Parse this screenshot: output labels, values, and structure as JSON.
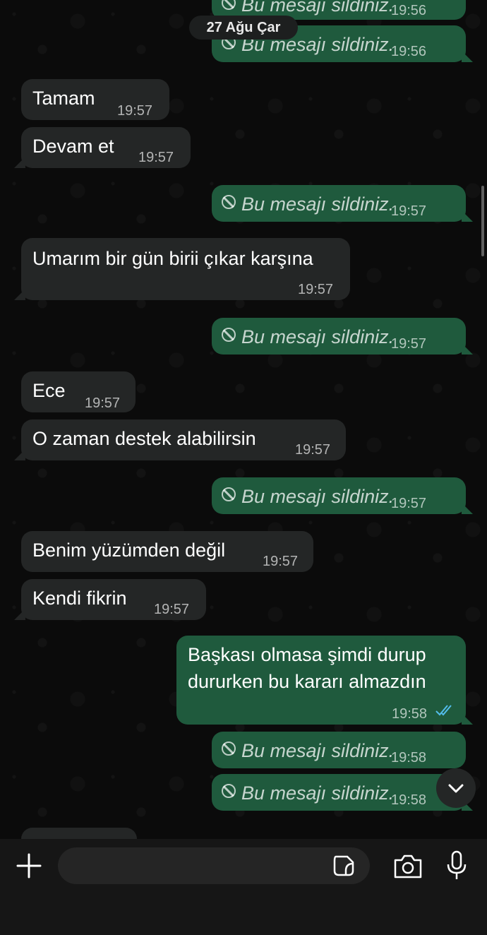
{
  "header": {
    "date": "27 Ağu Çar"
  },
  "messages": [
    {
      "dir": "out",
      "deleted": true,
      "text": "Bu mesajı sildiniz.",
      "time": "19:56"
    },
    {
      "dir": "out",
      "deleted": true,
      "text": "Bu mesajı sildiniz.",
      "time": "19:56"
    },
    {
      "dir": "in",
      "text": "Tamam",
      "time": "19:57"
    },
    {
      "dir": "in",
      "text": "Devam et",
      "time": "19:57"
    },
    {
      "dir": "out",
      "deleted": true,
      "text": "Bu mesajı sildiniz.",
      "time": "19:57"
    },
    {
      "dir": "in",
      "text": "Umarım bir gün birii çıkar karşına",
      "time": "19:57"
    },
    {
      "dir": "out",
      "deleted": true,
      "text": "Bu mesajı sildiniz.",
      "time": "19:57"
    },
    {
      "dir": "in",
      "text": "Ece",
      "time": "19:57"
    },
    {
      "dir": "in",
      "text": "O zaman destek alabilirsin",
      "time": "19:57"
    },
    {
      "dir": "out",
      "deleted": true,
      "text": "Bu mesajı sildiniz.",
      "time": "19:57"
    },
    {
      "dir": "in",
      "text": "Benim yüzümden değil",
      "time": "19:57"
    },
    {
      "dir": "in",
      "text": "Kendi fikrin",
      "time": "19:57"
    },
    {
      "dir": "out",
      "text_line1": "Başkası olmasa şimdi durup",
      "text_line2": "dururken bu kararı almazdın",
      "time": "19:58",
      "status": "read"
    },
    {
      "dir": "out",
      "deleted": true,
      "text": "Bu mesajı sildiniz.",
      "time": "19:58"
    },
    {
      "dir": "out",
      "deleted": true,
      "text": "Bu mesajı sildiniz.",
      "time": "19:58"
    }
  ],
  "colors": {
    "incoming_bubble": "#242626",
    "outgoing_bubble": "#1f5a3d",
    "read_ticks": "#53bdeb",
    "background": "#0b0b0b"
  },
  "composer": {
    "input_value": "",
    "icons": [
      "plus-icon",
      "sticker-icon",
      "camera-icon",
      "microphone-icon"
    ]
  },
  "scroll_down_icon": "chevron-down-icon"
}
